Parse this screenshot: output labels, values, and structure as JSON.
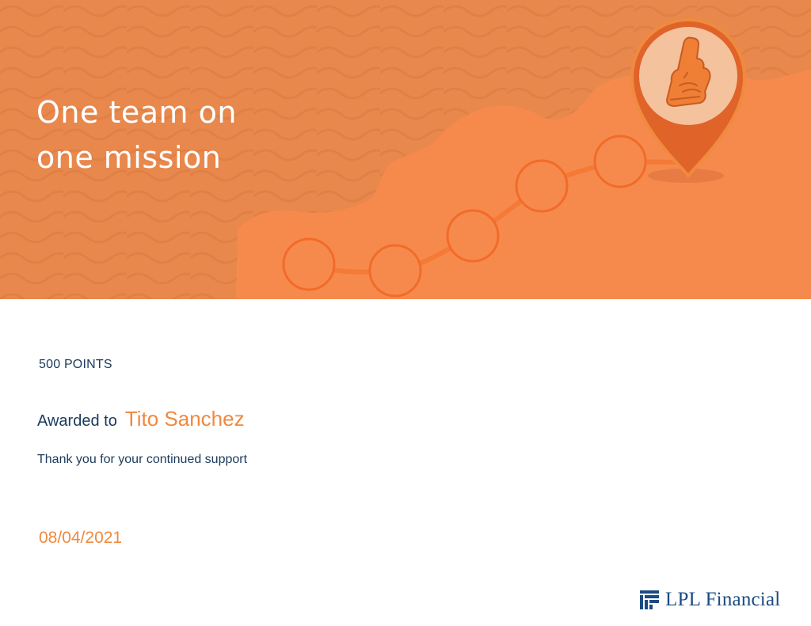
{
  "banner": {
    "headline_line1": "One team on",
    "headline_line2": "one mission",
    "colors": {
      "background": "#e8884c",
      "land": "#f68a4c",
      "milestone_ring": "#f26b2a",
      "pin": "#e0632a",
      "pin_inner": "#f4c29c"
    },
    "pin_icon": "foam-finger-icon"
  },
  "award": {
    "points": "500 POINTS",
    "awarded_label": "Awarded to",
    "recipient": "Tito Sanchez",
    "message": "Thank you for your continued support",
    "date": "08/04/2021"
  },
  "brand": {
    "name": "LPL Financial",
    "color": "#1a4b84",
    "accent": "#f0893f"
  }
}
